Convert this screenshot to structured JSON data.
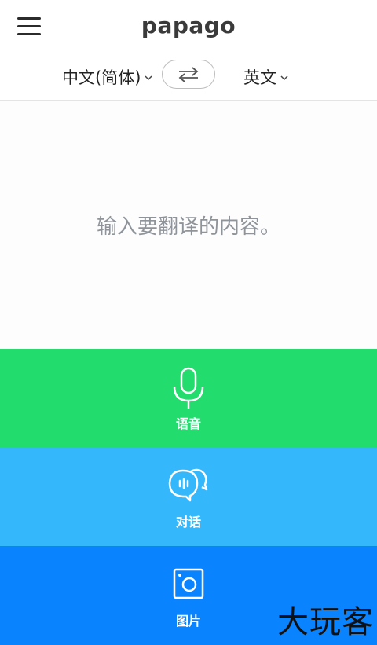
{
  "header": {
    "logo": "papago"
  },
  "languages": {
    "source": "中文(简体)",
    "target": "英文"
  },
  "input": {
    "placeholder": "输入要翻译的内容。"
  },
  "modes": {
    "voice": {
      "label": "语音",
      "color": "#22dc6e",
      "icon": "microphone-icon"
    },
    "conversation": {
      "label": "对话",
      "color": "#35b8fb",
      "icon": "chat-bubbles-icon"
    },
    "image": {
      "label": "图片",
      "color": "#0a84fe",
      "icon": "camera-icon"
    }
  },
  "watermark": {
    "text": "大玩客"
  }
}
